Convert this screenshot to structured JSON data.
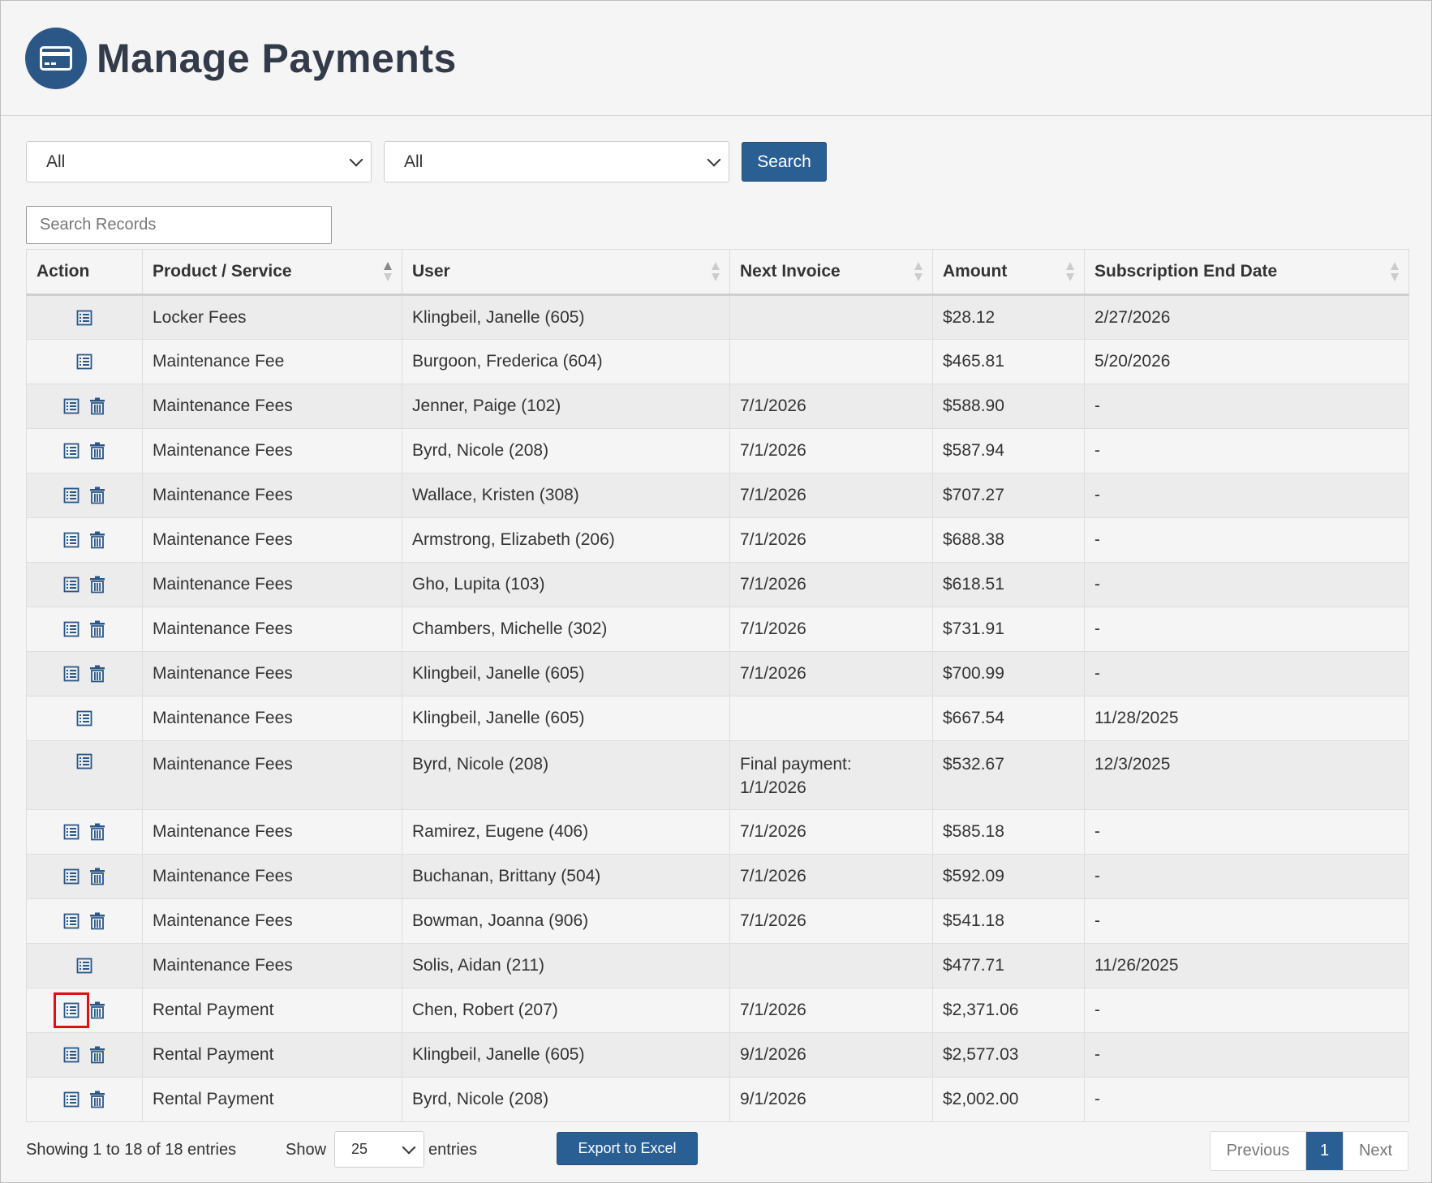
{
  "page": {
    "title": "Manage Payments"
  },
  "filters": {
    "select1_value": "All",
    "select2_value": "All",
    "search_label": "Search"
  },
  "search_records": {
    "placeholder": "Search Records"
  },
  "table": {
    "headers": [
      "Action",
      "Product / Service",
      "User",
      "Next Invoice",
      "Amount",
      "Subscription End Date"
    ],
    "rows": [
      {
        "product": "Locker Fees",
        "user": "Klingbeil, Janelle (605)",
        "next_invoice": "",
        "next_invoice_2": "",
        "amount": "$28.12",
        "end_date": "2/27/2026",
        "can_delete": false
      },
      {
        "product": "Maintenance Fee",
        "user": "Burgoon, Frederica (604)",
        "next_invoice": "",
        "next_invoice_2": "",
        "amount": "$465.81",
        "end_date": "5/20/2026",
        "can_delete": false
      },
      {
        "product": "Maintenance Fees",
        "user": "Jenner, Paige (102)",
        "next_invoice": "7/1/2026",
        "next_invoice_2": "",
        "amount": "$588.90",
        "end_date": "-",
        "can_delete": true
      },
      {
        "product": "Maintenance Fees",
        "user": "Byrd, Nicole (208)",
        "next_invoice": "7/1/2026",
        "next_invoice_2": "",
        "amount": "$587.94",
        "end_date": "-",
        "can_delete": true
      },
      {
        "product": "Maintenance Fees",
        "user": "Wallace, Kristen (308)",
        "next_invoice": "7/1/2026",
        "next_invoice_2": "",
        "amount": "$707.27",
        "end_date": "-",
        "can_delete": true
      },
      {
        "product": "Maintenance Fees",
        "user": "Armstrong, Elizabeth (206)",
        "next_invoice": "7/1/2026",
        "next_invoice_2": "",
        "amount": "$688.38",
        "end_date": "-",
        "can_delete": true
      },
      {
        "product": "Maintenance Fees",
        "user": "Gho, Lupita (103)",
        "next_invoice": "7/1/2026",
        "next_invoice_2": "",
        "amount": "$618.51",
        "end_date": "-",
        "can_delete": true
      },
      {
        "product": "Maintenance Fees",
        "user": "Chambers, Michelle (302)",
        "next_invoice": "7/1/2026",
        "next_invoice_2": "",
        "amount": "$731.91",
        "end_date": "-",
        "can_delete": true
      },
      {
        "product": "Maintenance Fees",
        "user": "Klingbeil, Janelle (605)",
        "next_invoice": "7/1/2026",
        "next_invoice_2": "",
        "amount": "$700.99",
        "end_date": "-",
        "can_delete": true
      },
      {
        "product": "Maintenance Fees",
        "user": "Klingbeil, Janelle (605)",
        "next_invoice": "",
        "next_invoice_2": "",
        "amount": "$667.54",
        "end_date": "11/28/2025",
        "can_delete": false
      },
      {
        "product": "Maintenance Fees",
        "user": "Byrd, Nicole (208)",
        "next_invoice": "Final payment:",
        "next_invoice_2": "1/1/2026",
        "amount": "$532.67",
        "end_date": "12/3/2025",
        "can_delete": false
      },
      {
        "product": "Maintenance Fees",
        "user": "Ramirez, Eugene (406)",
        "next_invoice": "7/1/2026",
        "next_invoice_2": "",
        "amount": "$585.18",
        "end_date": "-",
        "can_delete": true
      },
      {
        "product": "Maintenance Fees",
        "user": "Buchanan, Brittany (504)",
        "next_invoice": "7/1/2026",
        "next_invoice_2": "",
        "amount": "$592.09",
        "end_date": "-",
        "can_delete": true
      },
      {
        "product": "Maintenance Fees",
        "user": "Bowman, Joanna (906)",
        "next_invoice": "7/1/2026",
        "next_invoice_2": "",
        "amount": "$541.18",
        "end_date": "-",
        "can_delete": true
      },
      {
        "product": "Maintenance Fees",
        "user": "Solis, Aidan (211)",
        "next_invoice": "",
        "next_invoice_2": "",
        "amount": "$477.71",
        "end_date": "11/26/2025",
        "can_delete": false
      },
      {
        "product": "Rental Payment",
        "user": "Chen, Robert (207)",
        "next_invoice": "7/1/2026",
        "next_invoice_2": "",
        "amount": "$2,371.06",
        "end_date": "-",
        "can_delete": true,
        "highlighted": true
      },
      {
        "product": "Rental Payment",
        "user": "Klingbeil, Janelle (605)",
        "next_invoice": "9/1/2026",
        "next_invoice_2": "",
        "amount": "$2,577.03",
        "end_date": "-",
        "can_delete": true
      },
      {
        "product": "Rental Payment",
        "user": "Byrd, Nicole (208)",
        "next_invoice": "9/1/2026",
        "next_invoice_2": "",
        "amount": "$2,002.00",
        "end_date": "-",
        "can_delete": true
      }
    ]
  },
  "footer": {
    "showing": "Showing 1 to 18 of 18 entries",
    "show_label": "Show",
    "page_length": "25",
    "entries_label": "entries",
    "export_label": "Export to Excel",
    "previous": "Previous",
    "current_page": "1",
    "next": "Next"
  },
  "colors": {
    "primary": "#2a5f93",
    "highlight": "#e01010",
    "icon": "#2b5786"
  },
  "icons": {
    "logo": "credit-card-icon",
    "view": "list-icon",
    "delete": "trash-icon"
  }
}
